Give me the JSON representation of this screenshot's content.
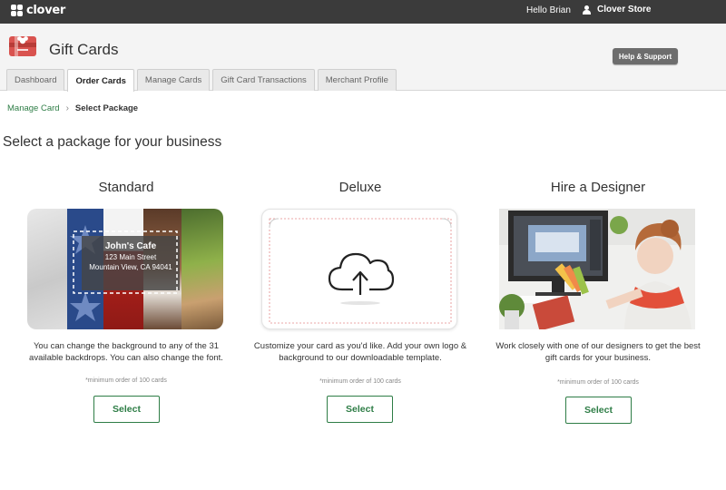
{
  "topbar": {
    "brand": "clover",
    "greeting": "Hello Brian",
    "store_name": "Clover Store"
  },
  "header": {
    "app_title": "Gift Cards",
    "help_label": "Help & Support",
    "tabs": [
      {
        "label": "Dashboard",
        "active": false
      },
      {
        "label": "Order Cards",
        "active": true
      },
      {
        "label": "Manage Cards",
        "active": false
      },
      {
        "label": "Gift Card Transactions",
        "active": false
      },
      {
        "label": "Merchant Profile",
        "active": false
      }
    ]
  },
  "breadcrumb": {
    "link": "Manage Card",
    "separator": "›",
    "current": "Select Package"
  },
  "main": {
    "heading": "Select a package for your business",
    "packages": [
      {
        "title": "Standard",
        "description": "You can change the background to any of the 31 available backdrops. You can also change the font.",
        "note": "*minimum order of 100 cards",
        "button": "Select",
        "card_preview": {
          "name": "John's Cafe",
          "address": "123 Main Street",
          "city": "Mountain View, CA 94041"
        }
      },
      {
        "title": "Deluxe",
        "description": "Customize your card as you'd like. Add your own logo & background to our downloadable template.",
        "note": "*minimum order of 100 cards",
        "button": "Select",
        "card_preview": {
          "icon": "cloud-upload-icon"
        }
      },
      {
        "title": "Hire a Designer",
        "description": "Work closely with one of our designers to get the best gift cards for your business.",
        "note": "*minimum order of 100 cards",
        "button": "Select",
        "card_preview": {
          "image": "designer-photo"
        }
      }
    ]
  },
  "colors": {
    "topbar": "#3b3b3b",
    "accent_green": "#2e7d46",
    "help_button": "#6d6d6d",
    "app_icon_red": "#d9534f"
  }
}
